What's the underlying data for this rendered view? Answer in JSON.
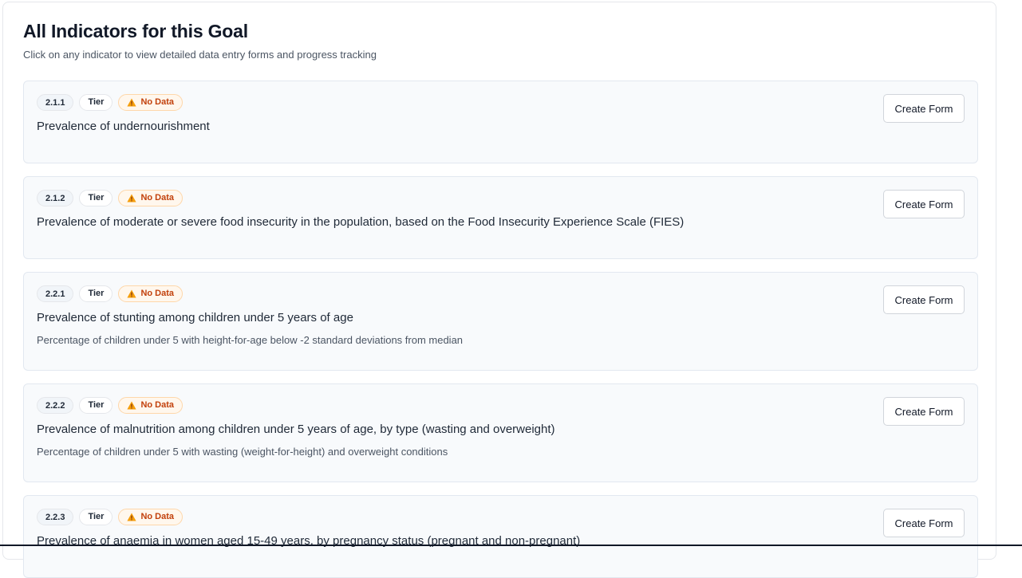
{
  "header": {
    "title": "All Indicators for this Goal",
    "subtitle": "Click on any indicator to view detailed data entry forms and progress tracking"
  },
  "indicators": [
    {
      "code": "2.1.1",
      "tier": "Tier",
      "status": "No Data",
      "title": "Prevalence of undernourishment",
      "description": "",
      "action_label": "Create Form"
    },
    {
      "code": "2.1.2",
      "tier": "Tier",
      "status": "No Data",
      "title": "Prevalence of moderate or severe food insecurity in the population, based on the Food Insecurity Experience Scale (FIES)",
      "description": "",
      "action_label": "Create Form"
    },
    {
      "code": "2.2.1",
      "tier": "Tier",
      "status": "No Data",
      "title": "Prevalence of stunting among children under 5 years of age",
      "description": "Percentage of children under 5 with height-for-age below -2 standard deviations from median",
      "action_label": "Create Form"
    },
    {
      "code": "2.2.2",
      "tier": "Tier",
      "status": "No Data",
      "title": "Prevalence of malnutrition among children under 5 years of age, by type (wasting and overweight)",
      "description": "Percentage of children under 5 with wasting (weight-for-height) and overweight conditions",
      "action_label": "Create Form"
    },
    {
      "code": "2.2.3",
      "tier": "Tier",
      "status": "No Data",
      "title": "Prevalence of anaemia in women aged 15-49 years, by pregnancy status (pregnant and non-pregnant)",
      "description": "",
      "action_label": "Create Form"
    }
  ],
  "icons": {
    "status": "warning-triangle-icon"
  },
  "colors": {
    "status_text": "#c2410c",
    "status_bg": "#fff7ed",
    "card_bg": "#f8fafc"
  }
}
